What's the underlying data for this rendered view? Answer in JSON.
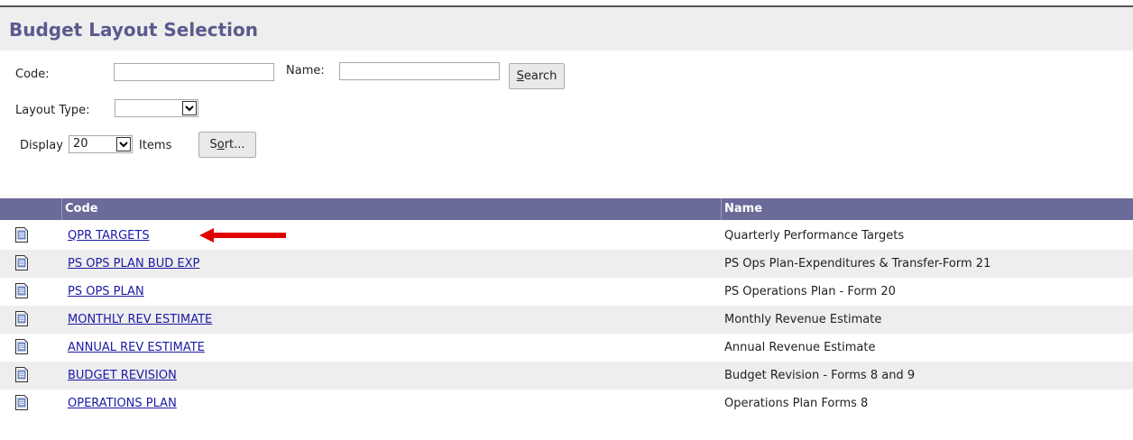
{
  "page": {
    "title": "Budget Layout Selection"
  },
  "filters": {
    "code_label": "Code:",
    "code_value": "",
    "name_label": "Name:",
    "name_value": "",
    "search_label_pre": "",
    "search_label_ul": "S",
    "search_label_post": "earch",
    "layout_type_label": "Layout Type:",
    "layout_type_value": "",
    "display_label": "Display",
    "display_value": "20",
    "items_label": "Items",
    "sort_label_pre": "S",
    "sort_label_ul": "o",
    "sort_label_post": "rt..."
  },
  "table": {
    "headers": {
      "code": "Code",
      "name": "Name"
    },
    "rows": [
      {
        "code": "QPR TARGETS",
        "name": "Quarterly Performance Targets"
      },
      {
        "code": "PS OPS PLAN BUD EXP",
        "name": "PS Ops Plan-Expenditures & Transfer-Form 21"
      },
      {
        "code": "PS OPS PLAN",
        "name": "PS Operations Plan - Form 20"
      },
      {
        "code": "MONTHLY REV ESTIMATE",
        "name": "Monthly Revenue Estimate"
      },
      {
        "code": "ANNUAL REV ESTIMATE",
        "name": "Annual Revenue Estimate"
      },
      {
        "code": "BUDGET REVISION",
        "name": "Budget Revision - Forms 8 and 9"
      },
      {
        "code": "OPERATIONS PLAN",
        "name": "Operations Plan Forms 8"
      }
    ]
  },
  "colors": {
    "header_bg": "#6b6b99",
    "title": "#5a5a8e",
    "link": "#1a1aa6",
    "annotation": "#e00000"
  },
  "icons": {
    "row_icon": "document-icon",
    "annotation": "red-arrow-left-icon"
  }
}
